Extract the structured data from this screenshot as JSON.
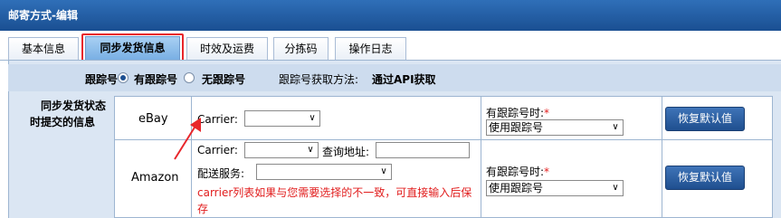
{
  "window": {
    "title": "邮寄方式-编辑"
  },
  "tabs": [
    {
      "label": "基本信息"
    },
    {
      "label": "同步发货信息"
    },
    {
      "label": "时效及运费"
    },
    {
      "label": "分拣码"
    },
    {
      "label": "操作日志"
    }
  ],
  "tracking": {
    "label": "跟踪号",
    "option_with": "有跟踪号",
    "option_without": "无跟踪号",
    "method_label": "跟踪号获取方法:",
    "method_value": "通过API获取"
  },
  "section": {
    "label_line1": "同步发货状态",
    "label_line2": "时提交的信息"
  },
  "platforms": [
    {
      "name": "eBay",
      "carrier_label": "Carrier:",
      "carrier_value": "",
      "right_label": "有跟踪号时:",
      "required_mark": "*",
      "right_select": "使用跟踪号",
      "button": "恢复默认值"
    },
    {
      "name": "Amazon",
      "carrier_label": "Carrier:",
      "carrier_value": "",
      "query_label": "查询地址:",
      "query_value": "",
      "service_label": "配送服务:",
      "service_value": "",
      "note": "carrier列表如果与您需要选择的不一致，可直接输入后保存",
      "right_label": "有跟踪号时:",
      "required_mark": "*",
      "right_select": "使用跟踪号",
      "button": "恢复默认值"
    }
  ],
  "colors": {
    "title_bar": "#1f5ca3",
    "active_tab": "#8cbfec",
    "highlight": "#e8262b",
    "button": "#2a5d9f",
    "note": "#e11c1c"
  }
}
